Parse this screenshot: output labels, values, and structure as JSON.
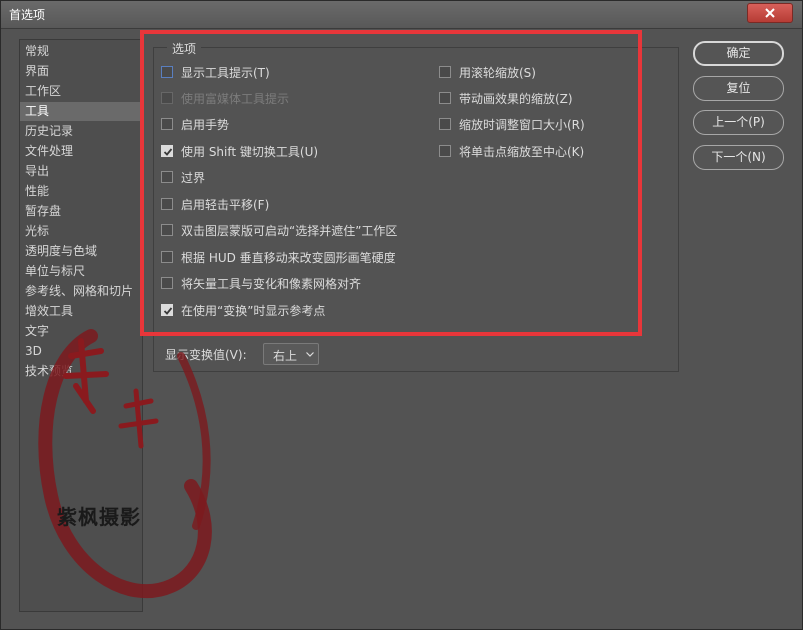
{
  "window": {
    "title": "首选项"
  },
  "sidebar": {
    "items": [
      "常规",
      "界面",
      "工作区",
      "工具",
      "历史记录",
      "文件处理",
      "导出",
      "性能",
      "暂存盘",
      "光标",
      "透明度与色域",
      "单位与标尺",
      "参考线、网格和切片",
      "增效工具",
      "文字",
      "3D",
      "技术预览"
    ],
    "selected": "工具"
  },
  "options": {
    "group_label": "选项",
    "left": [
      {
        "label": "显示工具提示(T)",
        "checked": false,
        "enabled": true
      },
      {
        "label": "使用富媒体工具提示",
        "checked": false,
        "enabled": false
      },
      {
        "label": "启用手势",
        "checked": false,
        "enabled": true
      },
      {
        "label": "使用 Shift 键切换工具(U)",
        "checked": true,
        "enabled": true
      },
      {
        "label": "过界",
        "checked": false,
        "enabled": true
      },
      {
        "label": "启用轻击平移(F)",
        "checked": false,
        "enabled": true
      },
      {
        "label": "双击图层蒙版可启动“选择并遮住”工作区",
        "checked": false,
        "enabled": true
      },
      {
        "label": "根据 HUD 垂直移动来改变圆形画笔硬度",
        "checked": false,
        "enabled": true
      },
      {
        "label": "将矢量工具与变化和像素网格对齐",
        "checked": false,
        "enabled": true
      },
      {
        "label": "在使用“变换”时显示参考点",
        "checked": true,
        "enabled": true
      }
    ],
    "right": [
      {
        "label": "用滚轮缩放(S)",
        "checked": false,
        "enabled": true
      },
      {
        "label": "带动画效果的缩放(Z)",
        "checked": false,
        "enabled": true
      },
      {
        "label": "缩放时调整窗口大小(R)",
        "checked": false,
        "enabled": true
      },
      {
        "label": "将单击点缩放至中心(K)",
        "checked": false,
        "enabled": true
      }
    ],
    "transform_label": "显示变换值(V):",
    "transform_value": "右上"
  },
  "buttons": {
    "ok": "确定",
    "reset": "复位",
    "prev": "上一个(P)",
    "next": "下一个(N)"
  },
  "watermark": {
    "text": "紫枫摄影",
    "color": "#8a1a1e"
  },
  "colors": {
    "highlight": "#e8363a",
    "panel": "#535353",
    "close": "#c24740"
  }
}
